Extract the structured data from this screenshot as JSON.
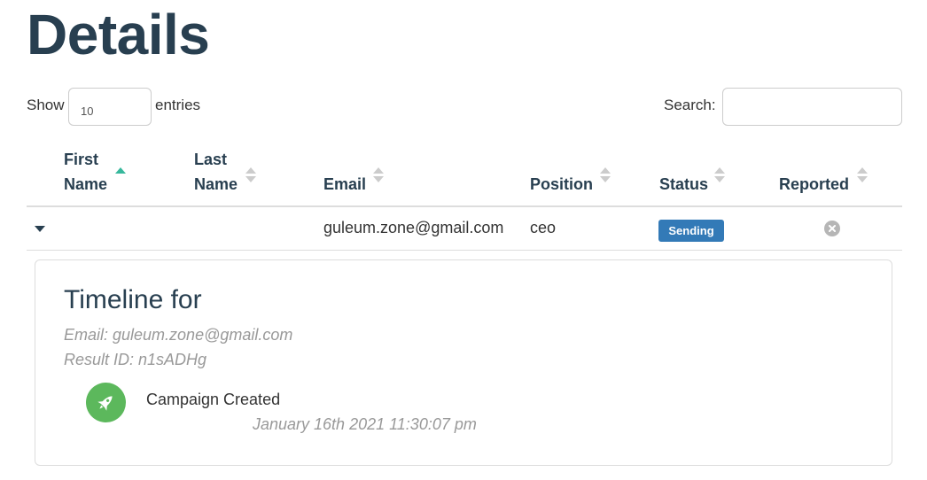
{
  "page": {
    "title": "Details"
  },
  "controls": {
    "show_label": "Show",
    "entries_value": "10",
    "entries_label": "entries",
    "search_label": "Search:",
    "search_value": ""
  },
  "table": {
    "columns": [
      {
        "line1": "First",
        "line2": "Name",
        "sort": "ascending"
      },
      {
        "line1": "Last",
        "line2": "Name",
        "sort": "none"
      },
      {
        "line1": "",
        "line2": "Email",
        "sort": "none"
      },
      {
        "line1": "",
        "line2": "Position",
        "sort": "none"
      },
      {
        "line1": "",
        "line2": "Status",
        "sort": "none"
      },
      {
        "line1": "",
        "line2": "Reported",
        "sort": "none"
      }
    ],
    "rows": [
      {
        "expand_icon": "caret-down-icon",
        "first_name": "",
        "last_name": "",
        "email": "guleum.zone@gmail.com",
        "position": "ceo",
        "status": "Sending",
        "status_color": "#337ab7",
        "reported_icon": "times-circle-icon"
      }
    ]
  },
  "timeline": {
    "title": "Timeline for",
    "email_line": "Email: guleum.zone@gmail.com",
    "result_line": "Result ID: n1sADHg",
    "events": [
      {
        "icon": "rocket-icon",
        "icon_color": "#5cb85c",
        "label": "Campaign Created",
        "time": "January 16th 2021 11:30:07 pm"
      }
    ]
  }
}
